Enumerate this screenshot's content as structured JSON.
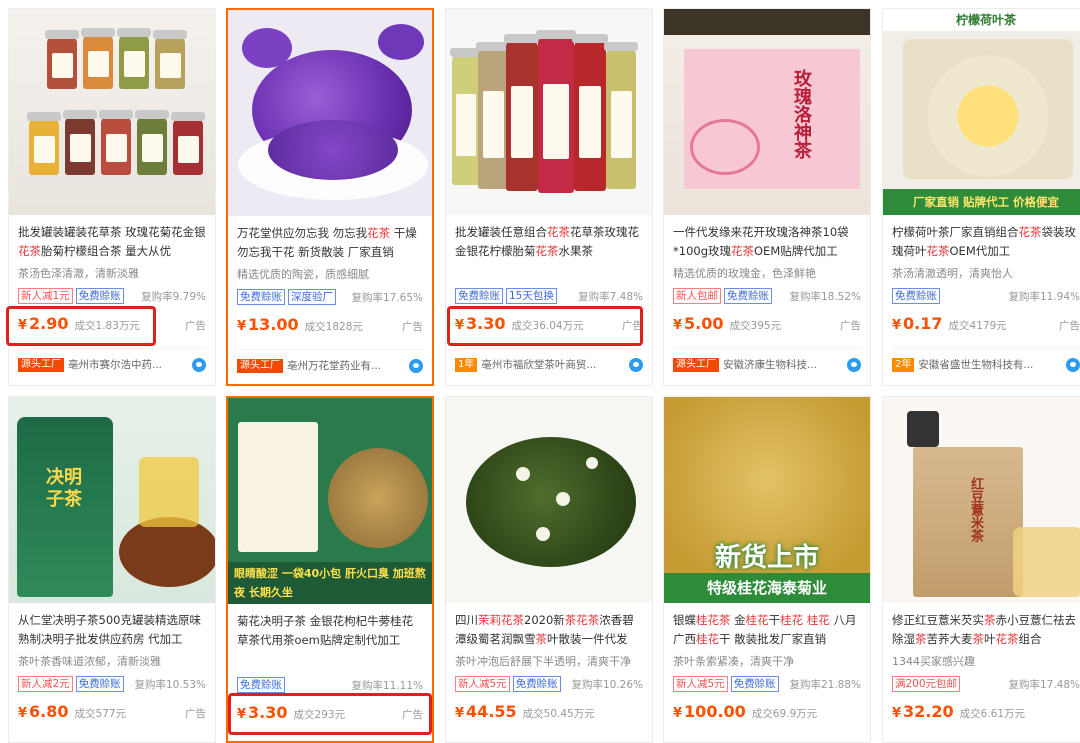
{
  "products": [
    {
      "title_parts": [
        [
          "批发罐装罐装花草茶 玫瑰花菊花金银",
          ""
        ],
        [
          "花茶",
          "kw"
        ],
        [
          "胎菊柠檬组合茶 量大从优",
          ""
        ]
      ],
      "sub": "茶汤色泽清澈，清新淡雅",
      "tags": [
        [
          "新人减1元",
          "red"
        ],
        [
          "免费赊账",
          "blue"
        ]
      ],
      "repurchase": "复购率9.79%",
      "price": "2.90",
      "deal": "成交1.83万元",
      "ad": "广告",
      "shop_badge": "源头工厂",
      "shop_name": "亳州市赛尔浩中药..."
    },
    {
      "image_text": "",
      "title_parts": [
        [
          "万花堂供应勿忘我 勿忘我",
          ""
        ],
        [
          "花茶",
          "kw"
        ],
        [
          " 干燥勿忘我干花 新货散装 厂家直销",
          ""
        ]
      ],
      "sub": "精选优质的陶瓷，质感细腻",
      "tags": [
        [
          "免费赊账",
          "blue"
        ],
        [
          "深度验厂",
          "blue"
        ]
      ],
      "repurchase": "复购率17.65%",
      "price": "13.00",
      "deal": "成交1828元",
      "ad": "广告",
      "shop_badge": "源头工厂",
      "shop_name": "亳州万花堂药业有..."
    },
    {
      "title_parts": [
        [
          "批发罐装任意组合",
          ""
        ],
        [
          "花茶",
          "kw"
        ],
        [
          "花草茶玫瑰花金银花柠檬胎菊",
          ""
        ],
        [
          "花茶",
          "kw"
        ],
        [
          "水果茶",
          ""
        ]
      ],
      "sub": "",
      "tags": [
        [
          "免费赊账",
          "blue"
        ],
        [
          "15天包换",
          "blue"
        ]
      ],
      "repurchase": "复购率7.48%",
      "price": "3.30",
      "deal": "成交36.04万元",
      "ad": "广告",
      "shop_badge": "1年",
      "shop_name": "亳州市福欣堂茶叶商贸..."
    },
    {
      "image_text": "玫瑰洛神茶",
      "title_parts": [
        [
          "一件代发缘来花开玫瑰洛神茶10袋*100g玫瑰",
          ""
        ],
        [
          "花茶",
          "kw"
        ],
        [
          "OEM贴牌代加工",
          ""
        ]
      ],
      "sub": "精选优质的玫瑰金，色泽鲜艳",
      "tags": [
        [
          "新人包邮",
          "red"
        ],
        [
          "免费赊账",
          "blue"
        ]
      ],
      "repurchase": "复购率18.52%",
      "price": "5.00",
      "deal": "成交395元",
      "ad": "广告",
      "shop_badge": "源头工厂",
      "shop_name": "安徽济康生物科技..."
    },
    {
      "image_top": "柠檬荷叶茶",
      "image_text": "厂家直销 贴牌代工 价格便宜",
      "title_parts": [
        [
          "柠檬荷叶茶厂家直销组合",
          ""
        ],
        [
          "花茶",
          "kw"
        ],
        [
          "袋装玫瑰荷叶",
          ""
        ],
        [
          "花茶",
          "kw"
        ],
        [
          "OEM代加工",
          ""
        ]
      ],
      "sub": "茶汤清澈透明，清爽怡人",
      "tags": [
        [
          "免费赊账",
          "blue"
        ]
      ],
      "repurchase": "复购率11.94%",
      "price": "0.17",
      "deal": "成交4179元",
      "ad": "广告",
      "shop_badge": "2年",
      "shop_name": "安徽省盛世生物科技有..."
    },
    {
      "image_text": "决明子茶",
      "title_parts": [
        [
          "从仁堂决明子茶500克罐装精选原味熟制决明子批发供应药房 代加工",
          ""
        ]
      ],
      "sub": "茶叶茶香味道浓郁，清新淡雅",
      "tags": [
        [
          "新人减2元",
          "red"
        ],
        [
          "免费赊账",
          "blue"
        ]
      ],
      "repurchase": "复购率10.53%",
      "price": "6.80",
      "deal": "成交577元",
      "ad": "广告"
    },
    {
      "image_text": "眼睛酸涩 一袋40小包 肝火口臭 加班熬夜 长期久坐",
      "title_parts": [
        [
          "菊花决明子茶 金银花枸杞牛蒡桂花草茶代用茶oem贴牌定制代加工",
          ""
        ]
      ],
      "sub": "",
      "tags": [
        [
          "免费赊账",
          "blue"
        ]
      ],
      "repurchase": "复购率11.11%",
      "price": "3.30",
      "deal": "成交293元",
      "ad": "广告"
    },
    {
      "title_parts": [
        [
          "四川",
          ""
        ],
        [
          "茉莉花茶",
          "kw"
        ],
        [
          "2020新",
          ""
        ],
        [
          "茶花茶",
          "kw"
        ],
        [
          "浓香碧潭级蜀茗润飘雪",
          ""
        ],
        [
          "茶",
          "kw"
        ],
        [
          "叶散装一件代发",
          ""
        ]
      ],
      "sub": "茶叶冲泡后舒展下半透明，清爽干净",
      "tags": [
        [
          "新人减5元",
          "red"
        ],
        [
          "免费赊账",
          "blue"
        ]
      ],
      "repurchase": "复购率10.26%",
      "price": "44.55",
      "deal": "成交50.45万元",
      "ad": ""
    },
    {
      "image_text": "新货上市",
      "image_sub": "特级桂花海泰菊业",
      "title_parts": [
        [
          "银蝶",
          ""
        ],
        [
          "桂花茶",
          "kw"
        ],
        [
          " 金",
          ""
        ],
        [
          "桂花",
          "kw"
        ],
        [
          "干",
          ""
        ],
        [
          "桂花",
          "kw"
        ],
        [
          " ",
          ""
        ],
        [
          "桂花",
          "kw"
        ],
        [
          " 八月广西",
          ""
        ],
        [
          "桂花",
          "kw"
        ],
        [
          "干 散装批发厂家直销",
          ""
        ]
      ],
      "sub": "茶叶条索紧凑，清爽干净",
      "tags": [
        [
          "新人减5元",
          "red"
        ],
        [
          "免费赊账",
          "blue"
        ]
      ],
      "repurchase": "复购率21.88%",
      "price": "100.00",
      "deal": "成交69.9万元",
      "ad": ""
    },
    {
      "image_text": "红豆薏米茶",
      "title_parts": [
        [
          "修正红豆薏米芡实",
          ""
        ],
        [
          "茶",
          "kw"
        ],
        [
          "赤小豆薏仁祛去除湿",
          ""
        ],
        [
          "茶",
          "kw"
        ],
        [
          "苦荞大麦",
          ""
        ],
        [
          "茶",
          "kw"
        ],
        [
          "叶",
          ""
        ],
        [
          "花茶",
          "kw"
        ],
        [
          "组合",
          ""
        ]
      ],
      "sub": "1344买家感兴趣",
      "tags": [
        [
          "满200元包邮",
          "red"
        ]
      ],
      "repurchase": "复购率17.48%",
      "price": "32.20",
      "deal": "成交6.61万元",
      "ad": ""
    }
  ],
  "currency": "¥",
  "colors": {
    "price": "#ff5000",
    "keyword": "#e4393c",
    "highlight": "#e0211b"
  }
}
